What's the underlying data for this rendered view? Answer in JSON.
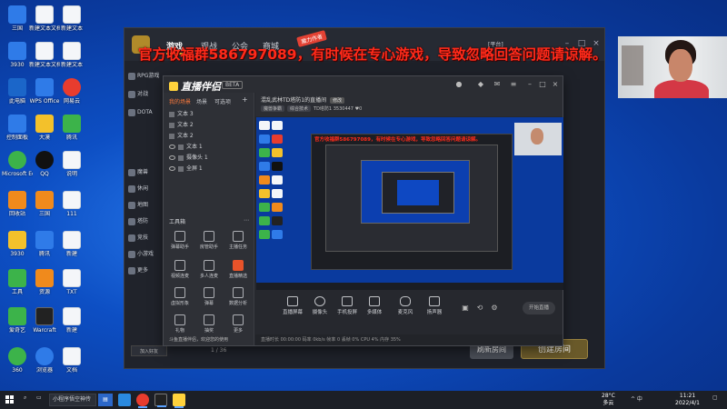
{
  "desktop": {
    "icons": [
      {
        "label": "三国"
      },
      {
        "label": "3930"
      },
      {
        "label": "新建文本文档"
      },
      {
        "label": "新建文本"
      },
      {
        "label": "此电脑"
      },
      {
        "label": "WPS Office"
      },
      {
        "label": "网易云"
      },
      {
        "label": "控制面板"
      },
      {
        "label": "大漠"
      },
      {
        "label": "腾讯"
      },
      {
        "label": "Microsoft Edge"
      },
      {
        "label": "QQ"
      },
      {
        "label": "说明"
      },
      {
        "label": "回收站"
      },
      {
        "label": "三国"
      },
      {
        "label": "111"
      },
      {
        "label": "3930"
      },
      {
        "label": "腾讯"
      },
      {
        "label": "新建"
      },
      {
        "label": "工具"
      },
      {
        "label": "资源"
      },
      {
        "label": "TXT"
      },
      {
        "label": "爱奇艺"
      },
      {
        "label": "Warcraft"
      },
      {
        "label": "新建"
      },
      {
        "label": "360"
      },
      {
        "label": "浏览器"
      },
      {
        "label": "文档"
      }
    ]
  },
  "launcher": {
    "tabs": [
      {
        "label": "游戏"
      },
      {
        "label": "观战"
      },
      {
        "label": "公会"
      },
      {
        "label": "商城"
      }
    ],
    "new_badge": "魔力作者",
    "user_label": "[平台]",
    "sidebar": [
      {
        "label": "RPG游戏"
      },
      {
        "label": "对战"
      },
      {
        "label": "DOTA"
      },
      {
        "label": "魔兽"
      },
      {
        "label": "休闲"
      },
      {
        "label": "地图"
      },
      {
        "label": "塔防"
      },
      {
        "label": "竞技"
      },
      {
        "label": "小游戏"
      },
      {
        "label": "更多"
      }
    ],
    "add_friend_label": "加入好友",
    "page_label": "1 / 36",
    "refresh_button": "刷新房间",
    "create_room_button": "创建房间"
  },
  "overlay_text": "官方收福群586797089，有时候在专心游戏，导致忽略回答问题请谅解。",
  "stream": {
    "brand": "直播伴侣",
    "version_chip": "BETA",
    "left_tabs": [
      {
        "label": "我的场景"
      },
      {
        "label": "场景"
      },
      {
        "label": "可选项"
      }
    ],
    "scenes": [
      {
        "label": "文本 3"
      },
      {
        "label": "文本 2"
      },
      {
        "label": "文本 2"
      },
      {
        "label": "文本 1"
      },
      {
        "label": "摄像头 1"
      },
      {
        "label": "全屏 1"
      }
    ],
    "tools_heading": "工具箱",
    "tools": [
      {
        "label": "弹幕助手"
      },
      {
        "label": "房管助手"
      },
      {
        "label": "主播任务"
      },
      {
        "label": "视频连麦"
      },
      {
        "label": "多人连麦"
      },
      {
        "label": "直播精选"
      },
      {
        "label": "虚拟形象"
      },
      {
        "label": "弹幕"
      },
      {
        "label": "数据分析"
      },
      {
        "label": "礼物"
      },
      {
        "label": "抽奖"
      },
      {
        "label": "更多"
      }
    ],
    "ad_text": "斗鱼直播伴侣，欢迎您的使用",
    "room_title": "混乱武林TD塔防1的直播间",
    "room_tag": "修改",
    "room_meta": [
      "魔兽争霸",
      "综合技术",
      "TD塔防1",
      "3530447",
      "0"
    ],
    "actions": [
      {
        "label": "直播屏幕"
      },
      {
        "label": "摄像头"
      },
      {
        "label": "手机投屏"
      },
      {
        "label": "多媒体"
      },
      {
        "label": "麦克风"
      },
      {
        "label": "扬声器"
      }
    ],
    "go_live": "开始直播",
    "status_text": "直播时长 00:00:00    码率 0kb/s    帧率 0    丢帧 0%    CPU 4%    内存 35%"
  },
  "taskbar": {
    "search_label": "小程序悟空神传",
    "weather": [
      "28°C",
      "多云"
    ],
    "clock": [
      "11:21",
      "2022/4/1"
    ],
    "tray_text": "^ 中"
  },
  "colors": {
    "overlay_red": "#ff2a1a",
    "accent_orange": "#e8532a",
    "tab_gold": "#f0b429"
  }
}
